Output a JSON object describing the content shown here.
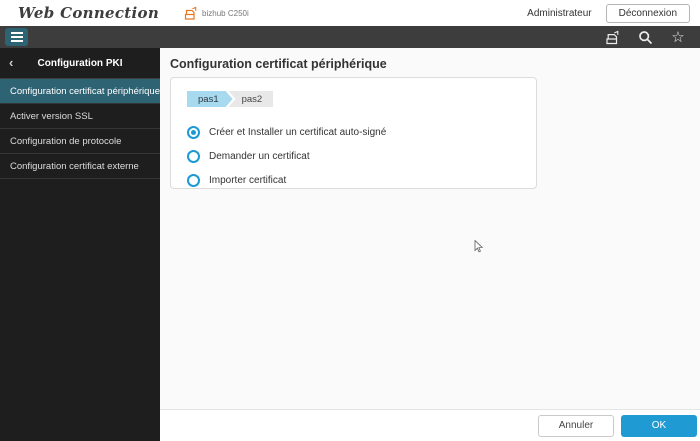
{
  "header": {
    "logo_text": "Web Connection",
    "device_name": "bizhub C250i",
    "user_label": "Administrateur",
    "logout_label": "Déconnexion"
  },
  "sidebar": {
    "back_glyph": "‹",
    "title": "Configuration PKI",
    "items": [
      {
        "label": "Configuration certificat périphérique",
        "selected": true
      },
      {
        "label": "Activer version SSL",
        "selected": false
      },
      {
        "label": "Configuration de protocole",
        "selected": false
      },
      {
        "label": "Configuration certificat externe",
        "selected": false
      }
    ]
  },
  "main": {
    "title": "Configuration certificat périphérique",
    "steps": [
      {
        "label": "pas1",
        "active": true
      },
      {
        "label": "pas2",
        "active": false
      }
    ],
    "options": [
      {
        "label": "Créer et Installer un certificat auto-signé",
        "selected": true
      },
      {
        "label": "Demander un certificat",
        "selected": false
      },
      {
        "label": "Importer certificat",
        "selected": false
      }
    ]
  },
  "footer": {
    "cancel_label": "Annuler",
    "ok_label": "OK"
  },
  "icons": [
    "menu-icon",
    "device-icon",
    "search-icon",
    "favorite-star-icon",
    "back-chevron-icon",
    "mouse-cursor"
  ],
  "colors": {
    "accent_teal": "#2e6373",
    "accent_blue": "#1f9ad2",
    "step_active_bg": "#a7d9ef",
    "appbar_dark": "#3d3d3d",
    "sidebar_bg": "#1e1e1e"
  }
}
